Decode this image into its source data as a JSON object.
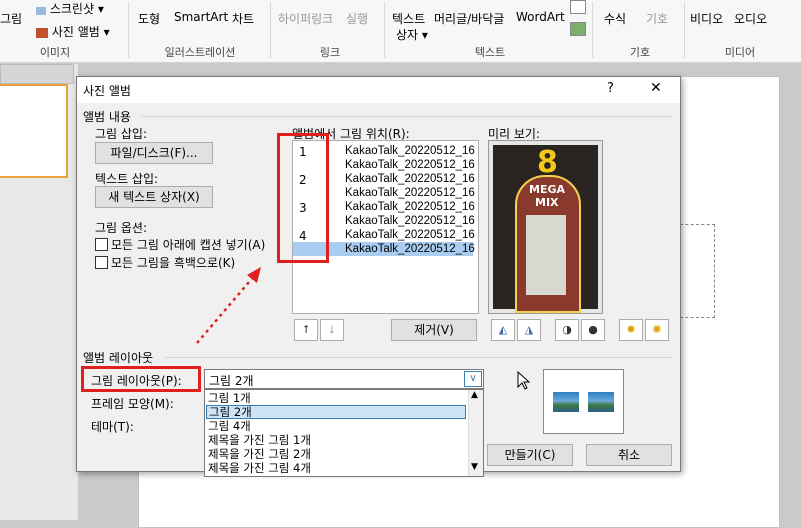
{
  "ribbon": {
    "picture": "그림",
    "screenshot": "스크린샷",
    "photo_album": "사진 앨범",
    "shapes": "도형",
    "smartart": "SmartArt",
    "chart": "차트",
    "hyperlink": "하이퍼링크",
    "action": "실행",
    "textbox": "텍스트",
    "textbox2": "상자",
    "header_footer": "머리글/바닥글",
    "wordart": "WordArt",
    "equation": "수식",
    "symbol": "기호",
    "video": "비디오",
    "audio": "오디오",
    "groups": {
      "images": "이미지",
      "illustrations": "일러스트레이션",
      "links": "링크",
      "text": "텍스트",
      "symbols": "기호",
      "media": "미디어"
    }
  },
  "dialog": {
    "title": "사진 앨범",
    "help": "?",
    "close": "✕",
    "album_content": "앨범 내용",
    "insert_picture_from": "그림 삽입:",
    "file_disk_button": "파일/디스크(F)...",
    "insert_text": "텍스트 삽입:",
    "new_textbox_button": "새 텍스트 상자(X)",
    "picture_options": "그림 옵션:",
    "option_caption": "모든 그림 아래에 캡션 넣기(A)",
    "option_bw": "모든 그림을 흑백으로(K)",
    "pictures_in_album": "앨범에서 그림 위치(R):",
    "preview": "미리 보기:",
    "list": {
      "numbers": [
        "1",
        "2",
        "3",
        "4"
      ],
      "items": [
        "KakaoTalk_20220512_16",
        "KakaoTalk_20220512_16",
        "KakaoTalk_20220512_16",
        "KakaoTalk_20220512_16",
        "KakaoTalk_20220512_16",
        "KakaoTalk_20220512_16",
        "KakaoTalk_20220512_16",
        "KakaoTalk_20220512_16"
      ]
    },
    "move_up": "⭡",
    "move_down": "⭣",
    "remove_button": "제거(V)",
    "preview_text": {
      "number": "8",
      "line1": "MEGA",
      "line2": "MIX"
    },
    "album_layout": "앨범 레이아웃",
    "picture_layout_label": "그림 레이아웃(P):",
    "picture_layout_value": "그림 2개",
    "frame_shape_label": "프레임 모양(M):",
    "theme_label": "테마(T):",
    "layout_options": [
      "그림 1개",
      "그림 2개",
      "그림 4개",
      "제목을 가진 그림 1개",
      "제목을 가진 그림 2개",
      "제목을 가진 그림 4개"
    ],
    "create_button": "만들기(C)",
    "cancel_button": "취소"
  },
  "colors": {
    "highlight": "#e0201e",
    "selection": "#a8cdf0"
  }
}
